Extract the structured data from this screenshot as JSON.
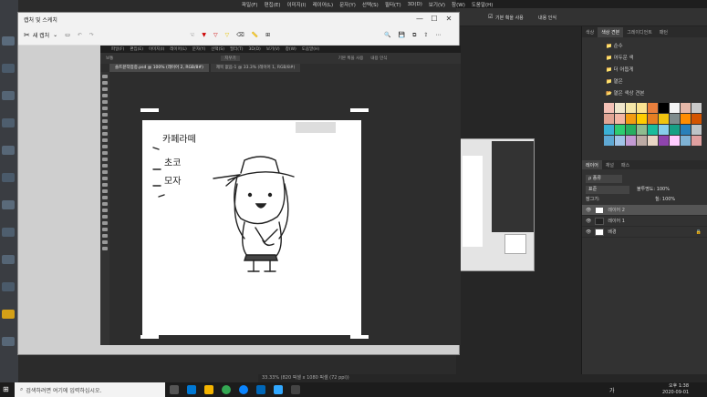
{
  "photoshop": {
    "menu": [
      "파일(F)",
      "편집(E)",
      "이미지(I)",
      "레이어(L)",
      "문자(Y)",
      "선택(S)",
      "필터(T)",
      "3D(D)",
      "보기(V)",
      "창(W)",
      "도움말(H)"
    ],
    "options": {
      "checkbox_label": "기본 획을 사용",
      "other_label": "내용 인식"
    },
    "panels": {
      "top_tabs": [
        "색상",
        "색상 견본",
        "그레이디언트",
        "패턴"
      ],
      "swatch_groups": [
        "순수",
        "어두운 색",
        "더 어둡게",
        "옅은",
        "옅은 색상 견본"
      ],
      "layer_tabs": [
        "레이어",
        "채널",
        "패스"
      ],
      "blend_mode": "표준",
      "opacity_label": "불투명도:",
      "opacity_value": "100%",
      "fill_label": "칠:",
      "fill_value": "100%",
      "lock_label": "잠그기:",
      "layers": [
        "레이어 2",
        "레이어 1",
        "배경"
      ]
    },
    "status": "33.33%    (820 픽셀 x 1080 픽셀 (72 ppi))"
  },
  "snip": {
    "title": "캡처 및 스케치",
    "new_label": "새 캡처",
    "inner": {
      "menu": [
        "파일(F)",
        "편집(E)",
        "이미지(I)",
        "레이어(L)",
        "문자(Y)",
        "선택(S)",
        "필터(T)",
        "3D(D)",
        "보기(V)",
        "창(W)",
        "도움말(H)"
      ],
      "tab_active": "솔트뮨작업중.psd @ 100% (레이어 2, RGB/8#)",
      "tab_other": "제목 없음-1 @ 33.3% (레이어 1, RGB/8#)",
      "opt_mode": "보통",
      "opt_btn": "지우기",
      "opt_check": "기본 획을 사용",
      "opt_other": "내용 인식",
      "drawing_text": [
        "카페라떼",
        "초코",
        "모자"
      ]
    }
  },
  "taskbar": {
    "search_placeholder": "검색하려면 여기에 입력하십시오.",
    "lang": "가",
    "time": "오후 1:38",
    "date": "2020-09-01"
  },
  "colors": {
    "swatches_row1": [
      "#f4c1b6",
      "#f0e6cc",
      "#f5e6a8",
      "#fbe391",
      "#e97f3d",
      "#000000",
      "#f4f4f4",
      "#e6b8a8",
      "#c9c9c9"
    ],
    "swatches_row2": [
      "#e0a494",
      "#f3b6a5",
      "#f39c12",
      "#ffcc00",
      "#e67e22",
      "#f1c40f",
      "#7f8c8d",
      "#ff8c00",
      "#d35400"
    ],
    "swatches_row3": [
      "#3ab0d4",
      "#2ecc71",
      "#27ae60",
      "#8fbc8f",
      "#1abc9c",
      "#87ceeb",
      "#16a085",
      "#2980b9",
      "#bdc3c7"
    ],
    "swatches_row4": [
      "#5fa8d3",
      "#a0c4e8",
      "#c39bd3",
      "#bcaaa4",
      "#e8d5c4",
      "#8e44ad",
      "#ffccff",
      "#7fb3d5",
      "#e0a0a0"
    ]
  }
}
